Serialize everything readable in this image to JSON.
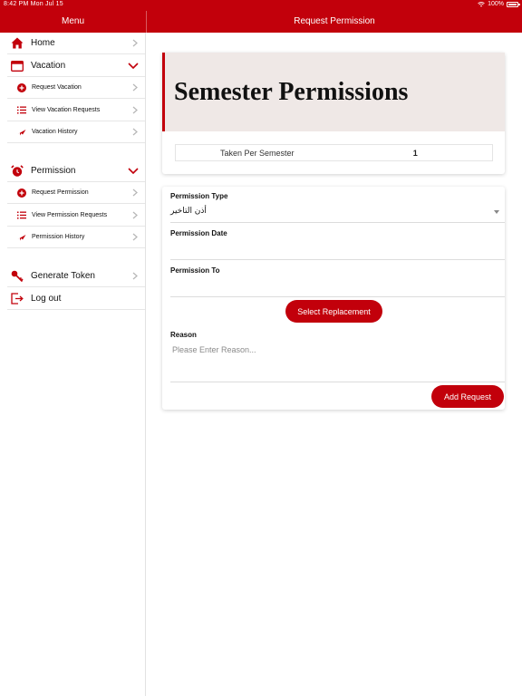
{
  "status_bar": {
    "time_date": "8:42 PM   Mon Jul 15",
    "battery": "100%"
  },
  "sidebar": {
    "title": "Menu",
    "items": [
      {
        "label": "Home"
      },
      {
        "label": "Vacation"
      },
      {
        "label": "Request Vacation"
      },
      {
        "label": "View Vacation Requests"
      },
      {
        "label": "Vacation History"
      },
      {
        "label": "Permission"
      },
      {
        "label": "Request Permission"
      },
      {
        "label": "View Permission Requests"
      },
      {
        "label": "Permission History"
      },
      {
        "label": "Generate Token"
      },
      {
        "label": "Log out"
      }
    ]
  },
  "header": {
    "title": "Request Permission"
  },
  "summary": {
    "title": "Semester Permissions",
    "taken_label": "Taken Per Semester",
    "taken_value": "1"
  },
  "form": {
    "type_label": "Permission Type",
    "type_value": "أذن التاخير",
    "date_label": "Permission Date",
    "to_label": "Permission To",
    "replacement_button": "Select Replacement",
    "reason_label": "Reason",
    "reason_placeholder": "Please Enter Reason...",
    "submit_button": "Add Request"
  },
  "colors": {
    "accent": "#c2000b",
    "header_bg": "#efe8e6"
  }
}
